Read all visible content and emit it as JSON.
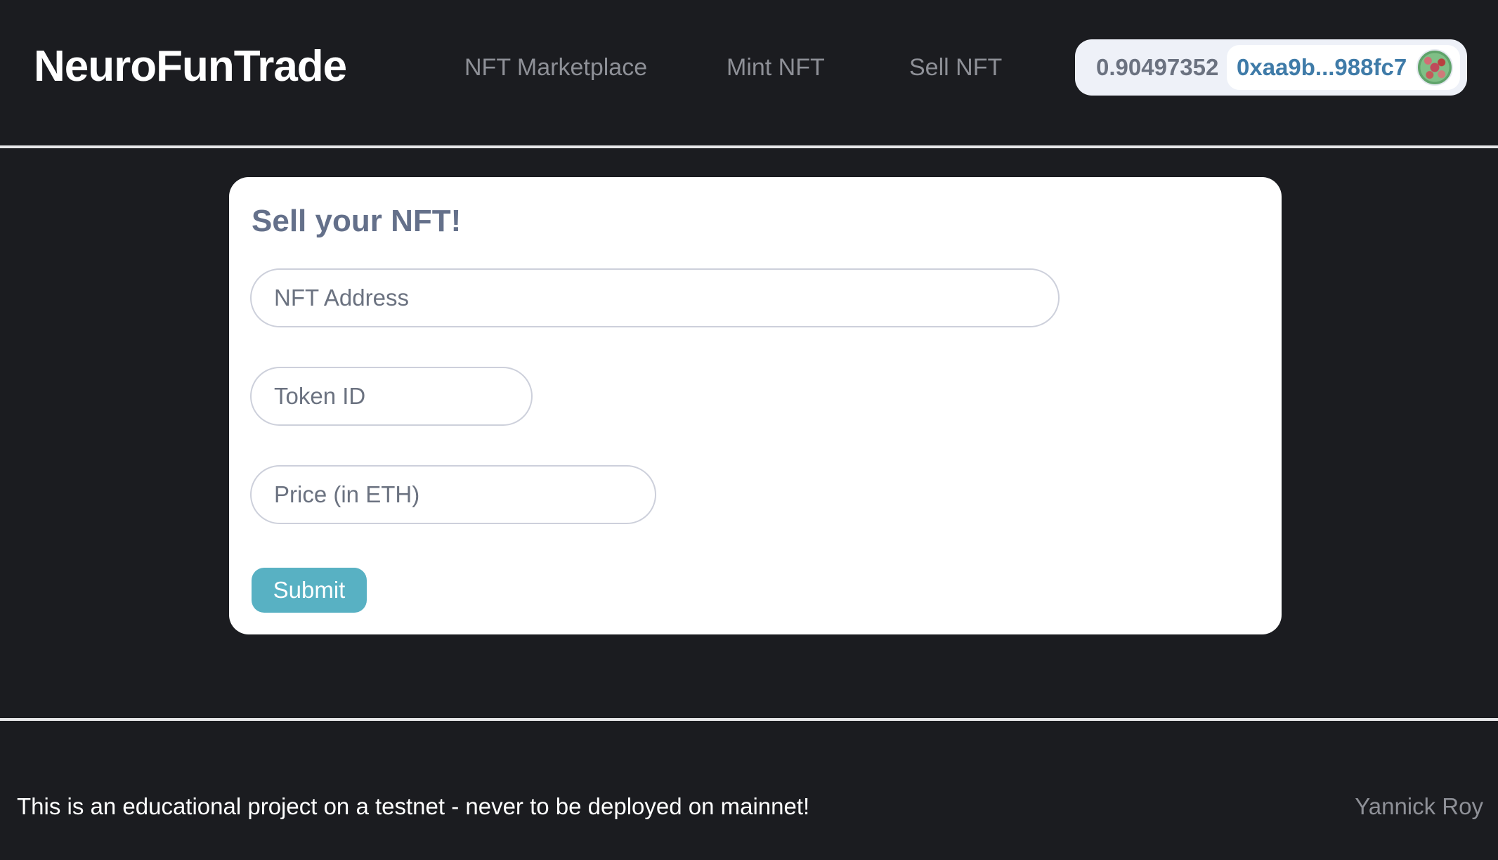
{
  "header": {
    "brand": "NeuroFunTrade",
    "nav": {
      "marketplace": "NFT Marketplace",
      "mint": "Mint NFT",
      "sell": "Sell NFT"
    },
    "wallet": {
      "balance": "0.90497352",
      "address": "0xaa9b...988fc7",
      "avatar_icon": "identicon-avatar"
    }
  },
  "sell_form": {
    "title": "Sell your NFT!",
    "nft_address_placeholder": "NFT Address",
    "nft_address_value": "",
    "token_id_placeholder": "Token ID",
    "token_id_value": "",
    "price_placeholder": "Price (in ETH)",
    "price_value": "",
    "submit_label": "Submit"
  },
  "footer": {
    "note": "This is an educational project on a testnet - never to be deployed on mainnet!",
    "author": "Yannick Roy"
  },
  "colors": {
    "background": "#1b1c20",
    "accent_button": "#58b1c3",
    "wallet_address": "#3f7ba8",
    "title_text": "#64708a"
  }
}
